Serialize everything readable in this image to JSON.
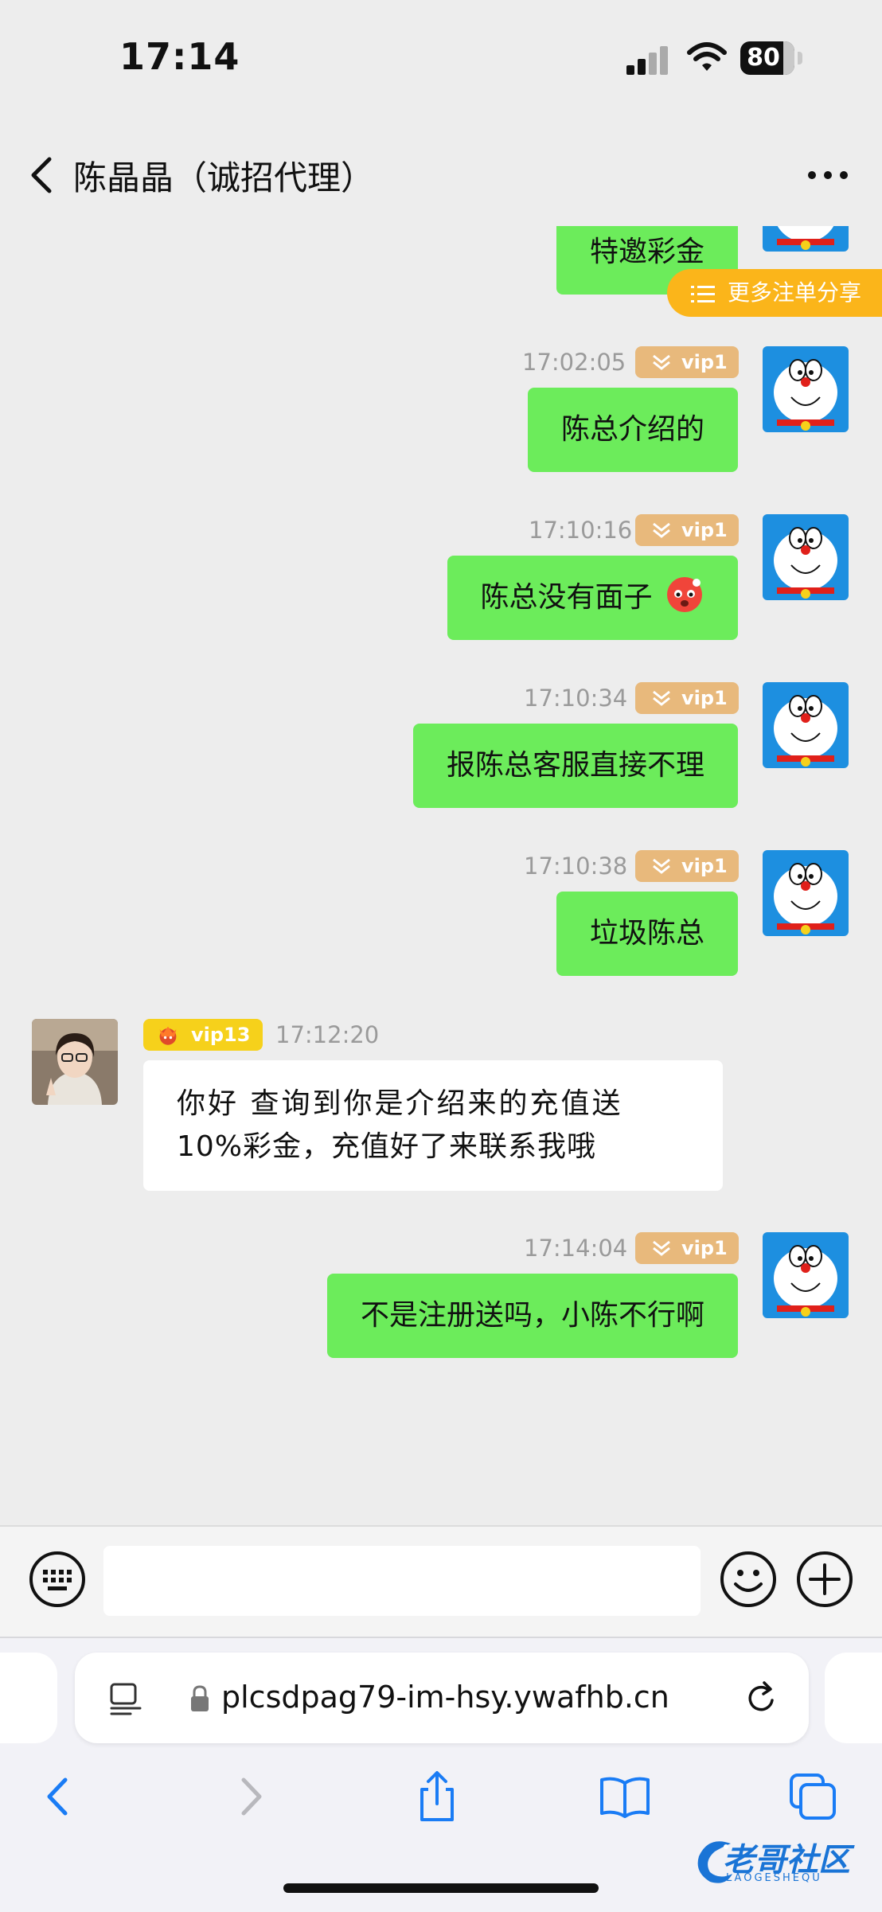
{
  "status_bar": {
    "time": "17:14",
    "battery": "80",
    "battery_level": 0.8
  },
  "header": {
    "title": "陈晶晶（诚招代理）"
  },
  "share_pill": {
    "label": "更多注单分享"
  },
  "messages": [
    {
      "direction": "out",
      "text": "特邀彩金",
      "partial": true
    },
    {
      "direction": "out",
      "time": "17:02:05",
      "vip": "vip1",
      "text": "陈总介绍的"
    },
    {
      "direction": "out",
      "time": "17:10:16",
      "vip": "vip1",
      "text": "陈总没有面子",
      "emoji": "angry-face"
    },
    {
      "direction": "out",
      "time": "17:10:34",
      "vip": "vip1",
      "text": "报陈总客服直接不理"
    },
    {
      "direction": "out",
      "time": "17:10:38",
      "vip": "vip1",
      "text": "垃圾陈总"
    },
    {
      "direction": "in",
      "time": "17:12:20",
      "vip": "vip13",
      "line1": "你好 查询到你是介绍来的充值送",
      "line2": "10%彩金，充值好了来联系我哦"
    },
    {
      "direction": "out",
      "time": "17:14:04",
      "vip": "vip1",
      "text": "不是注册送吗，小陈不行啊"
    }
  ],
  "composer": {
    "value": ""
  },
  "browser": {
    "url": "plcsdpag79-im-hsy.ywafhb.cn"
  },
  "watermark": {
    "title": "老哥社区",
    "subtitle": "LAOGESHEQU"
  },
  "colors": {
    "bubble_out": "#6cec5b",
    "vip1": "#e8b97c",
    "vip13": "#f6d11b",
    "share": "#fbb51a",
    "link": "#1a7cf5"
  }
}
